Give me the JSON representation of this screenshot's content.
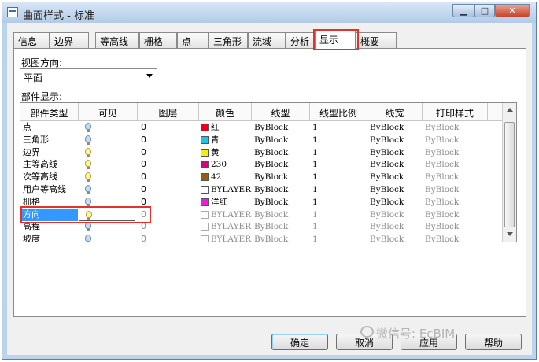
{
  "window": {
    "title": "曲面样式 - 标准"
  },
  "tabs": [
    "信息",
    "边界",
    "等高线",
    "栅格",
    "点",
    "三角形",
    "流域",
    "分析",
    "显示",
    "概要"
  ],
  "active_tab": "显示",
  "view_direction": {
    "label": "视图方向:",
    "value": "平面"
  },
  "component_display": {
    "label": "部件显示:",
    "columns": [
      "部件类型",
      "可见",
      "图层",
      "颜色",
      "线型",
      "线型比例",
      "线宽",
      "打印样式"
    ],
    "rows": [
      {
        "type": "点",
        "visible": "on",
        "layer": "0",
        "color_hex": "#e8001a",
        "color": "红",
        "linetype": "ByBlock",
        "scale": "1",
        "lineweight": "ByBlock",
        "plotstyle": "ByBlock"
      },
      {
        "type": "三角形",
        "visible": "on",
        "layer": "0",
        "color_hex": "#19c6e8",
        "color": "青",
        "linetype": "ByBlock",
        "scale": "1",
        "lineweight": "ByBlock",
        "plotstyle": "ByBlock"
      },
      {
        "type": "边界",
        "visible": "off",
        "layer": "0",
        "color_hex": "#f5ee0d",
        "color": "黄",
        "linetype": "ByBlock",
        "scale": "1",
        "lineweight": "ByBlock",
        "plotstyle": "ByBlock"
      },
      {
        "type": "主等高线",
        "visible": "off",
        "layer": "0",
        "color_hex": "#d9007a",
        "color": "230",
        "linetype": "ByBlock",
        "scale": "1",
        "lineweight": "ByBlock",
        "plotstyle": "ByBlock"
      },
      {
        "type": "次等高线",
        "visible": "off",
        "layer": "0",
        "color_hex": "#9a5b10",
        "color": "42",
        "linetype": "ByBlock",
        "scale": "1",
        "lineweight": "ByBlock",
        "plotstyle": "ByBlock"
      },
      {
        "type": "用户等高线",
        "visible": "on",
        "layer": "0",
        "color_hex": "#ffffff",
        "color": "BYLAYER",
        "linetype": "ByBlock",
        "scale": "1",
        "lineweight": "ByBlock",
        "plotstyle": "ByBlock"
      },
      {
        "type": "栅格",
        "visible": "on",
        "layer": "0",
        "color_hex": "#e61fd8",
        "color": "洋红",
        "linetype": "ByBlock",
        "scale": "1",
        "lineweight": "ByBlock",
        "plotstyle": "ByBlock"
      },
      {
        "type": "方向",
        "visible": "off",
        "layer": "0",
        "color_hex": "#ffffff",
        "color": "BYLAYER",
        "linetype": "ByBlock",
        "scale": "1",
        "lineweight": "ByBlock",
        "plotstyle": "ByBlock"
      },
      {
        "type": "高程",
        "visible": "on",
        "layer": "0",
        "color_hex": "#ffffff",
        "color": "BYLAYER",
        "linetype": "ByBlock",
        "scale": "1",
        "lineweight": "ByBlock",
        "plotstyle": "ByBlock"
      },
      {
        "type": "坡度",
        "visible": "on",
        "layer": "0",
        "color_hex": "#ffffff",
        "color": "BYLAYER",
        "linetype": "ByBlock",
        "scale": "1",
        "lineweight": "ByBlock",
        "plotstyle": "ByBlock"
      }
    ]
  },
  "buttons": {
    "ok": "确定",
    "cancel": "取消",
    "apply": "应用",
    "help": "帮助"
  },
  "watermark": "微信号: EcBIM"
}
